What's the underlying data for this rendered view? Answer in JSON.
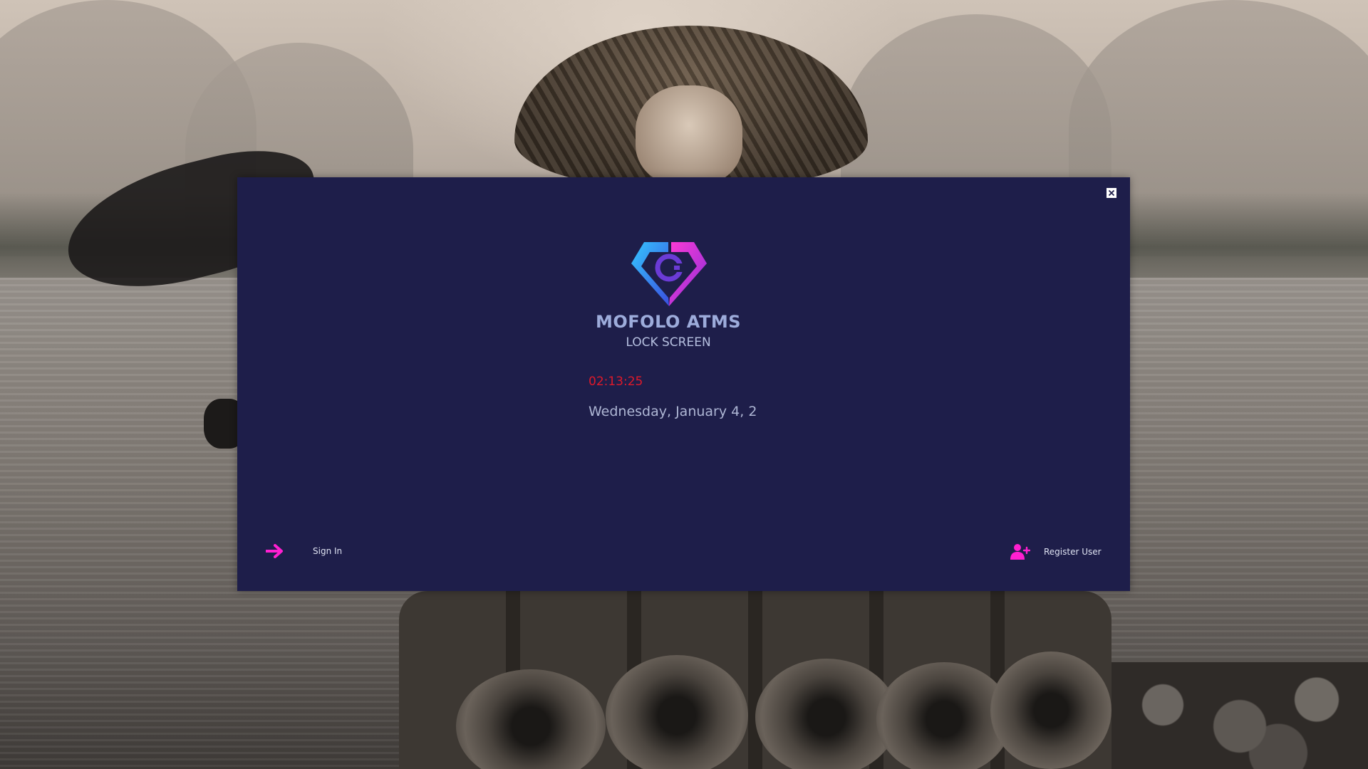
{
  "app": {
    "name": "MOFOLO ATMS",
    "subtitle": "LOCK SCREEN"
  },
  "clock": {
    "time": "02:13:25",
    "date": "Wednesday, January 4, 2"
  },
  "actions": {
    "sign_in_label": "Sign In",
    "register_label": "Register User"
  },
  "icons": {
    "close": "close-icon",
    "sign_in": "arrow-right-icon",
    "register": "user-plus-icon",
    "logo": "diamond-c-logo"
  },
  "colors": {
    "panel_bg": "#1e1e4a",
    "accent_magenta": "#ff1fd0",
    "logo_blue": "#2f8cff",
    "logo_purple": "#6b3bd6",
    "title_text": "#9dacdb",
    "clock_text": "#e0192a"
  }
}
